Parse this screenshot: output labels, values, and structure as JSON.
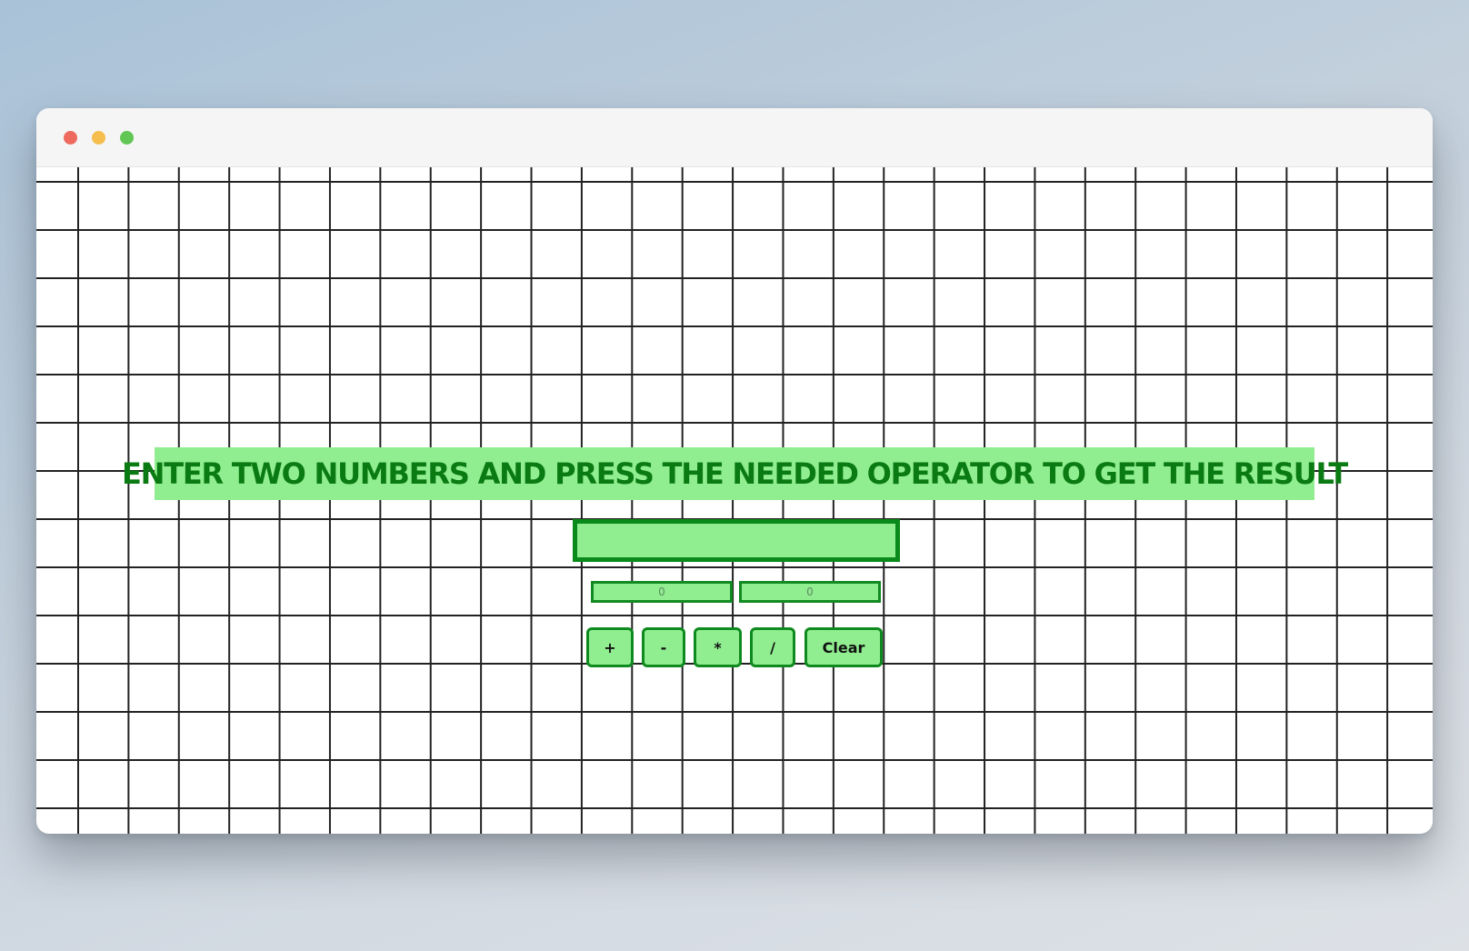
{
  "window": {
    "controls": [
      "close",
      "minimize",
      "maximize"
    ]
  },
  "colors": {
    "accent_fill": "#90ee90",
    "accent_border": "#0a8a1a",
    "heading_text": "#0a7a12",
    "grid_line": "#222222"
  },
  "heading": {
    "text": "ENTER TWO NUMBERS AND PRESS THE NEEDED OPERATOR TO GET THE RESULT"
  },
  "result": {
    "value": ""
  },
  "inputs": {
    "first": {
      "value": "",
      "placeholder": "0"
    },
    "second": {
      "value": "",
      "placeholder": "0"
    }
  },
  "operators": {
    "add": "+",
    "subtract": "-",
    "multiply": "*",
    "divide": "/",
    "clear": "Clear"
  }
}
